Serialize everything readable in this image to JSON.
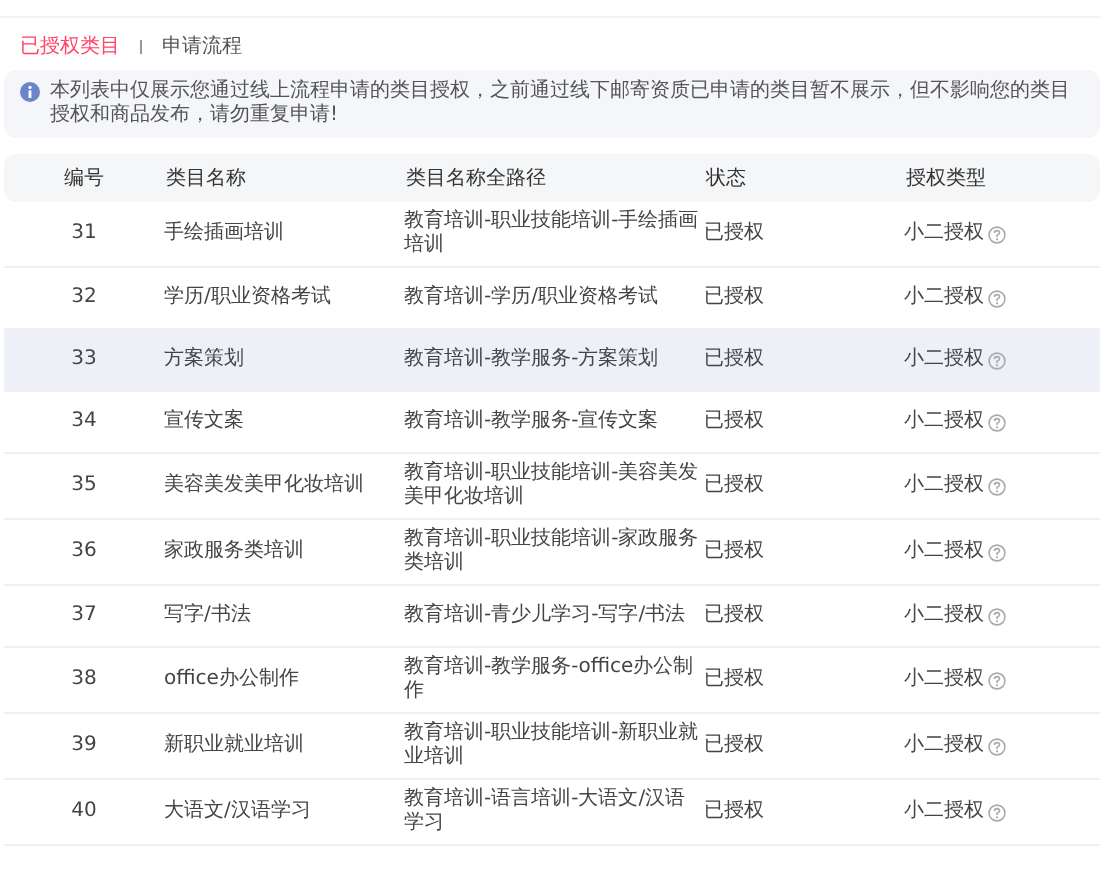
{
  "tabs": [
    {
      "label": "已授权类目",
      "selected": true
    },
    {
      "label": "申请流程",
      "selected": false
    }
  ],
  "notice": {
    "text": "本列表中仅展示您通过线上流程申请的类目授权，之前通过线下邮寄资质已申请的类目暂不展示，但不影响您的类目授权和商品发布，请勿重复申请!"
  },
  "table": {
    "columns": [
      "编号",
      "类目名称",
      "类目名称全路径",
      "状态",
      "授权类型"
    ],
    "rows": [
      {
        "id": "31",
        "name": "手绘插画培训",
        "path": "教育培训-职业技能培训-手绘插画培训",
        "status": "已授权",
        "auth_type": "小二授权",
        "highlighted": false
      },
      {
        "id": "32",
        "name": "学历/职业资格考试",
        "path": "教育培训-学历/职业资格考试",
        "status": "已授权",
        "auth_type": "小二授权",
        "highlighted": false
      },
      {
        "id": "33",
        "name": "方案策划",
        "path": "教育培训-教学服务-方案策划",
        "status": "已授权",
        "auth_type": "小二授权",
        "highlighted": true
      },
      {
        "id": "34",
        "name": "宣传文案",
        "path": "教育培训-教学服务-宣传文案",
        "status": "已授权",
        "auth_type": "小二授权",
        "highlighted": false
      },
      {
        "id": "35",
        "name": "美容美发美甲化妆培训",
        "path": "教育培训-职业技能培训-美容美发美甲化妆培训",
        "status": "已授权",
        "auth_type": "小二授权",
        "highlighted": false
      },
      {
        "id": "36",
        "name": "家政服务类培训",
        "path": "教育培训-职业技能培训-家政服务类培训",
        "status": "已授权",
        "auth_type": "小二授权",
        "highlighted": false
      },
      {
        "id": "37",
        "name": "写字/书法",
        "path": "教育培训-青少儿学习-写字/书法",
        "status": "已授权",
        "auth_type": "小二授权",
        "highlighted": false
      },
      {
        "id": "38",
        "name": "office办公制作",
        "path": "教育培训-教学服务-office办公制作",
        "status": "已授权",
        "auth_type": "小二授权",
        "highlighted": false
      },
      {
        "id": "39",
        "name": "新职业就业培训",
        "path": "教育培训-职业技能培训-新职业就业培训",
        "status": "已授权",
        "auth_type": "小二授权",
        "highlighted": false
      },
      {
        "id": "40",
        "name": "大语文/汉语学习",
        "path": "教育培训-语言培训-大语文/汉语学习",
        "status": "已授权",
        "auth_type": "小二授权",
        "highlighted": false
      }
    ]
  }
}
